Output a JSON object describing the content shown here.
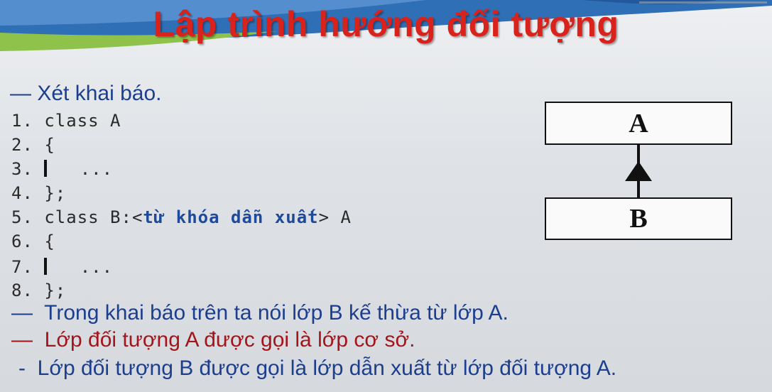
{
  "title": "Lập trình hướng đối tượng",
  "intro": "— Xét khai báo.",
  "code": [
    {
      "num": "1.",
      "text": "class A"
    },
    {
      "num": "2.",
      "text": "{"
    },
    {
      "num": "3.",
      "text": "..."
    },
    {
      "num": "4.",
      "text": "};"
    },
    {
      "num": "5.",
      "pre": "class B:<",
      "keyword": "từ khóa dẫn xuất",
      "post": "> A"
    },
    {
      "num": "6.",
      "text": "{"
    },
    {
      "num": "7.",
      "text": "..."
    },
    {
      "num": "8.",
      "text": "};"
    }
  ],
  "bullets": [
    {
      "dash": "—",
      "text": "Trong khai báo trên ta nói lớp B kế thừa từ lớp A."
    },
    {
      "dash": "—",
      "text": "Lớp đối tượng A được gọi là lớp cơ sở."
    },
    {
      "dash": "-",
      "text": "Lớp đối tượng B được gọi là lớp dẫn xuất từ lớp đối tượng A."
    }
  ],
  "diagram": {
    "top_class": "A",
    "bottom_class": "B"
  },
  "colors": {
    "title": "#d8221b",
    "blue_text": "#1c3e8f",
    "red_text": "#a3151b"
  }
}
